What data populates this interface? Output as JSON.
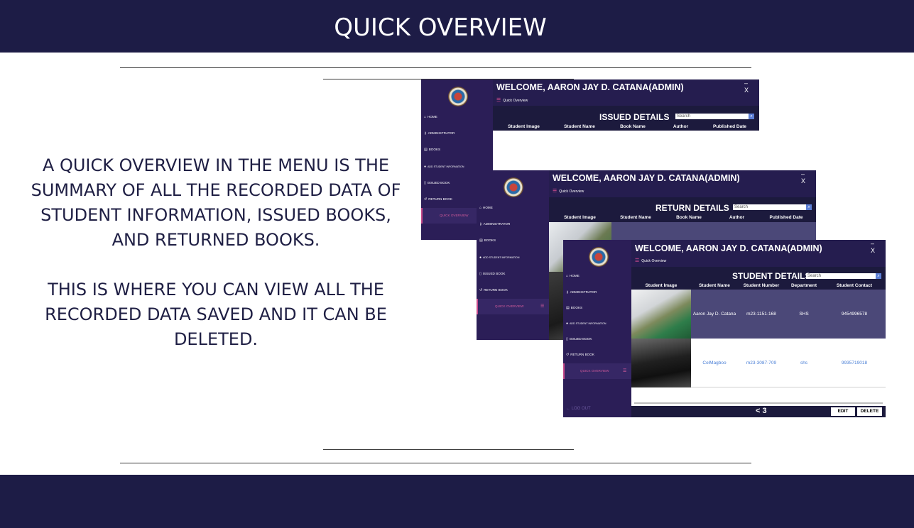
{
  "page": {
    "title": "QUICK OVERVIEW",
    "description_1": "A QUICK OVERVIEW IN THE MENU IS THE SUMMARY OF ALL THE RECORDED DATA OF STUDENT INFORMATION, ISSUED BOOKS, AND RETURNED BOOKS.",
    "description_2": "THIS IS WHERE YOU CAN VIEW ALL THE RECORDED DATA SAVED AND IT CAN BE DELETED."
  },
  "colors": {
    "band": "#1d1c46",
    "sidebar": "#2b1e57",
    "header": "#251d4f",
    "accent": "#c74a8b",
    "row_selected": "#4b4878",
    "link_text": "#4a7fd6"
  },
  "app": {
    "welcome": "WELCOME, AARON JAY D. CATANA(ADMIN)",
    "quick_overview_link": "Quick Overview",
    "window_controls": "– X",
    "search_placeholder": "Search",
    "logout": "← LOG OUT",
    "menu_icon": "hamburger-icon",
    "nav": {
      "home": "HOME",
      "administrator": "ADMINISTRATOR",
      "books": "BOOKS",
      "add_student": "ADD STUDENT INFORMATION",
      "issued_book": "ISSUED BOOK",
      "return_book": "RETURN BOOK",
      "quick_overview": "QUICK OVERVIEW"
    }
  },
  "issued": {
    "title": "ISSUED DETAILS",
    "columns": [
      "Student Image",
      "Student Name",
      "Book Name",
      "Author",
      "Published Date"
    ]
  },
  "returned": {
    "title": "RETURN DETAILS",
    "columns": [
      "Student Image",
      "Student Name",
      "Book Name",
      "Author",
      "Published Date"
    ]
  },
  "students": {
    "title": "STUDENT DETAILS",
    "columns": [
      "Student Image",
      "Student Name",
      "Student Number",
      "Department",
      "Student Contact"
    ],
    "rows": [
      {
        "name": "Aaron Jay D. Catana",
        "number": "m23-1151-168",
        "department": "SHS",
        "contact": "9454996578"
      },
      {
        "name": "CelMagboo",
        "number": "m23-3087-709",
        "department": "shs",
        "contact": "9935719018"
      }
    ],
    "pager": "<  3",
    "edit": "EDIT",
    "delete": "DELETE"
  }
}
